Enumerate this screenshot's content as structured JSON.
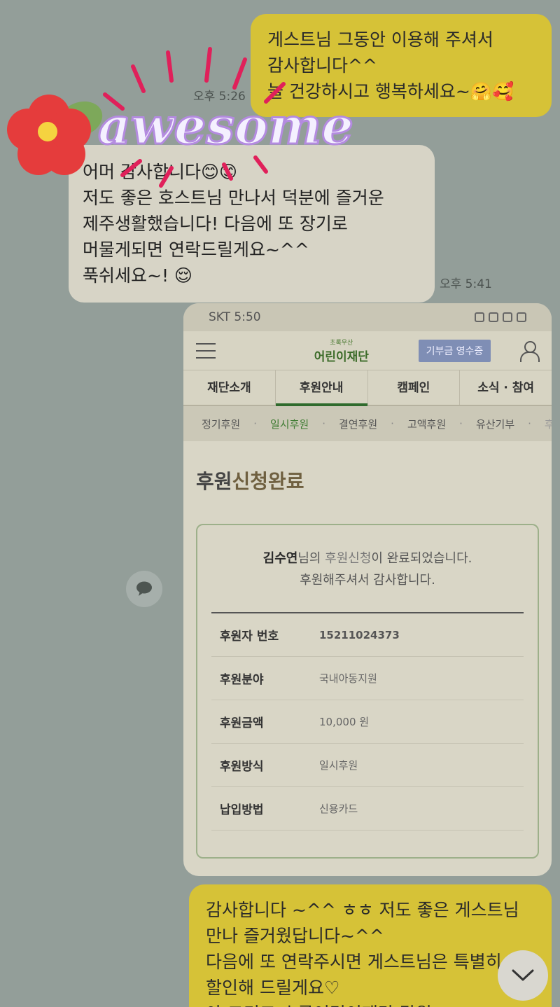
{
  "messages": {
    "top_right": {
      "lines": [
        "게스트님 그동안 이용해 주셔서",
        "감사합니다^^",
        "늘 건강하시고 행복하세요~🤗🥰"
      ],
      "time": "오후 5:26"
    },
    "left": {
      "lines": [
        "어머 감사합니다😊😊",
        "저도 좋은 호스트님 만나서 덕분에 즐거운",
        "제주생활했습니다! 다음에 또 장기로",
        "머물게되면 연락드릴게요~^^",
        "푹쉬세요~! 😌"
      ],
      "time": "오후 5:41"
    },
    "bottom_right": {
      "lines": [
        "감사합니다 ~^^ ㅎㅎ 저도 좋은 게스트님",
        "만나 즐거웠답니다~^^",
        "다음에 또 연락주시면 게스트님은 특별히",
        "할인해 드릴게요♡",
        "아 그리고 초록어린이재단 말원"
      ]
    }
  },
  "sticker": {
    "text": "awesome",
    "icon": "flower-icon"
  },
  "screenshot": {
    "statusbar": {
      "carrier_time": "SKT 5:50"
    },
    "appbar": {
      "logo_small": "초록우산",
      "logo_main": "어린이재단",
      "receipt_button": "기부금 영수증"
    },
    "tabs": [
      {
        "label": "재단소개"
      },
      {
        "label": "후원안내",
        "active": true
      },
      {
        "label": "캠페인"
      },
      {
        "label": "소식 · 참여"
      }
    ],
    "subtabs": [
      "정기후원",
      "일시후원",
      "결연후원",
      "고액후원",
      "유산기부",
      "후"
    ],
    "title_prefix": "후원",
    "title_accent": "신청완료",
    "message": {
      "name": "김수연",
      "mid": "님의 ",
      "highlight": "후원신청",
      "end": "이 완료되었습니다.",
      "line2": "후원해주셔서 감사합니다."
    },
    "rows": [
      {
        "key": "후원자 번호",
        "value": "15211024373"
      },
      {
        "key": "후원분야",
        "value": "국내아동지원"
      },
      {
        "key": "후원금액",
        "value": "10,000 원"
      },
      {
        "key": "후원방식",
        "value": "일시후원"
      },
      {
        "key": "납입방법",
        "value": "신용카드"
      }
    ]
  },
  "fabs": {
    "chat": "chat-bubble-icon",
    "scroll": "chevron-down-icon"
  },
  "colors": {
    "background": "#939e99",
    "my_bubble": "#d6c237",
    "their_bubble": "#d7d4c6",
    "accent_green": "#2f6b2d"
  }
}
